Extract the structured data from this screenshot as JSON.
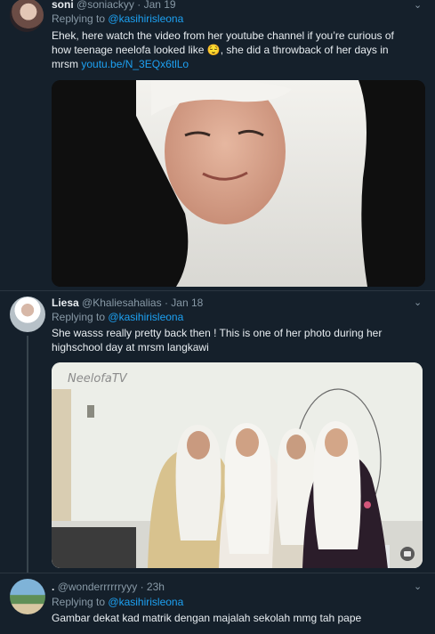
{
  "tweets": [
    {
      "name": "soni",
      "handle": "@soniackyy",
      "date": "Jan 19",
      "replying_label": "Replying to",
      "replying_to": "@kasihirisleona",
      "text_line1": "Ehek, here watch the video from her youtube channel if you’re curious of",
      "text_line2_a": "how teenage neelofa looked like",
      "emoji": "😌",
      "text_line2_b": ", she did a throwback of her days in",
      "text_line3": "mrsm",
      "link": "youtu.be/N_3EQx6tlLo"
    },
    {
      "name": "Liesa",
      "handle": "@Khaliesahalias",
      "date": "Jan 18",
      "replying_label": "Replying to",
      "replying_to": "@kasihirisleona",
      "text_line1": "She wasss really pretty back then ! This is one of her photo during her",
      "text_line2": "highschool day at mrsm langkawi",
      "photo_watermark": "NeelofaTV"
    },
    {
      "name": ".",
      "handle": "@wonderrrrrryyy",
      "date": "23h",
      "replying_label": "Replying to",
      "replying_to": "@kasihirisleona",
      "text_line1": "Gambar dekat kad matrik dengan majalah sekolah mmg tah pape"
    }
  ],
  "separator": "·",
  "icons": {
    "menu": "chevron-down-icon",
    "media_badge": "camera-icon"
  },
  "colors": {
    "background": "#15202b",
    "link": "#1da1f2",
    "muted": "#8899a6"
  }
}
